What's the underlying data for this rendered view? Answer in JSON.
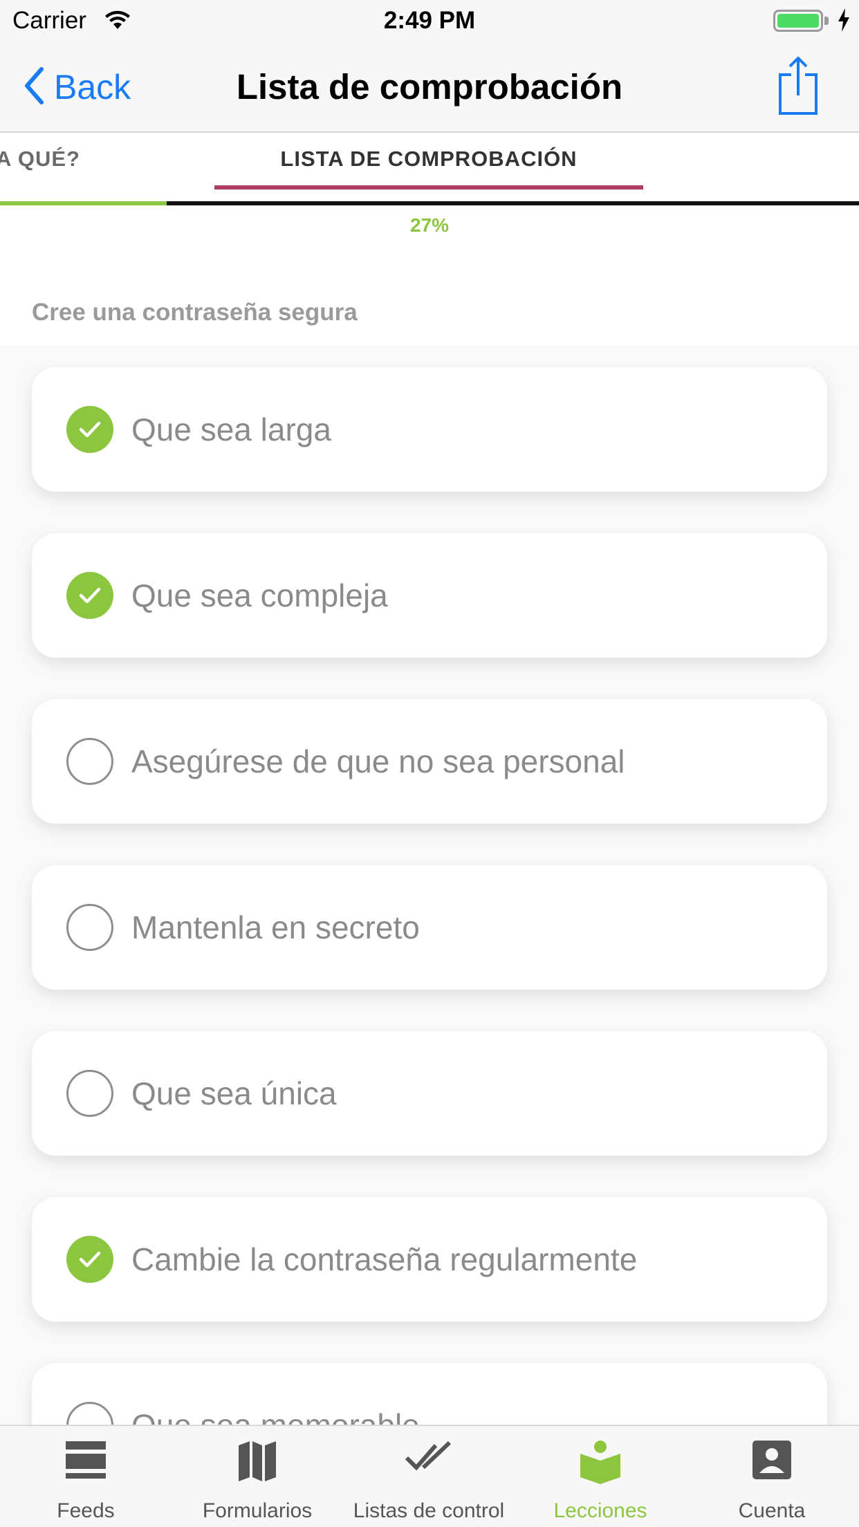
{
  "status_bar": {
    "carrier": "Carrier",
    "time": "2:49 PM"
  },
  "nav": {
    "back_label": "Back",
    "title": "Lista de comprobación",
    "share_icon": "share-icon"
  },
  "tabs": {
    "previous": "A QUÉ?",
    "active": "LISTA DE COMPROBACIÓN"
  },
  "progress": {
    "value": 0.27,
    "label": "27%"
  },
  "section_title": "Cree una contraseña segura",
  "checklist": [
    {
      "text": "Que sea larga",
      "checked": true
    },
    {
      "text": "Que sea compleja",
      "checked": true
    },
    {
      "text": "Asegúrese de que no sea personal",
      "checked": false
    },
    {
      "text": "Mantenla en secreto",
      "checked": false
    },
    {
      "text": "Que sea única",
      "checked": false
    },
    {
      "text": "Cambie la contraseña regularmente",
      "checked": true
    },
    {
      "text": "Que sea memorable",
      "checked": false
    }
  ],
  "tabbar": [
    {
      "label": "Feeds",
      "icon": "feeds-icon",
      "active": false
    },
    {
      "label": "Formularios",
      "icon": "map-icon",
      "active": false
    },
    {
      "label": "Listas de control",
      "icon": "double-check-icon",
      "active": false
    },
    {
      "label": "Lecciones",
      "icon": "lessons-icon",
      "active": true
    },
    {
      "label": "Cuenta",
      "icon": "account-icon",
      "active": false
    }
  ],
  "colors": {
    "accent_green": "#8cc63f",
    "tab_underline": "#b03a63",
    "link_blue": "#1a7cf5"
  }
}
